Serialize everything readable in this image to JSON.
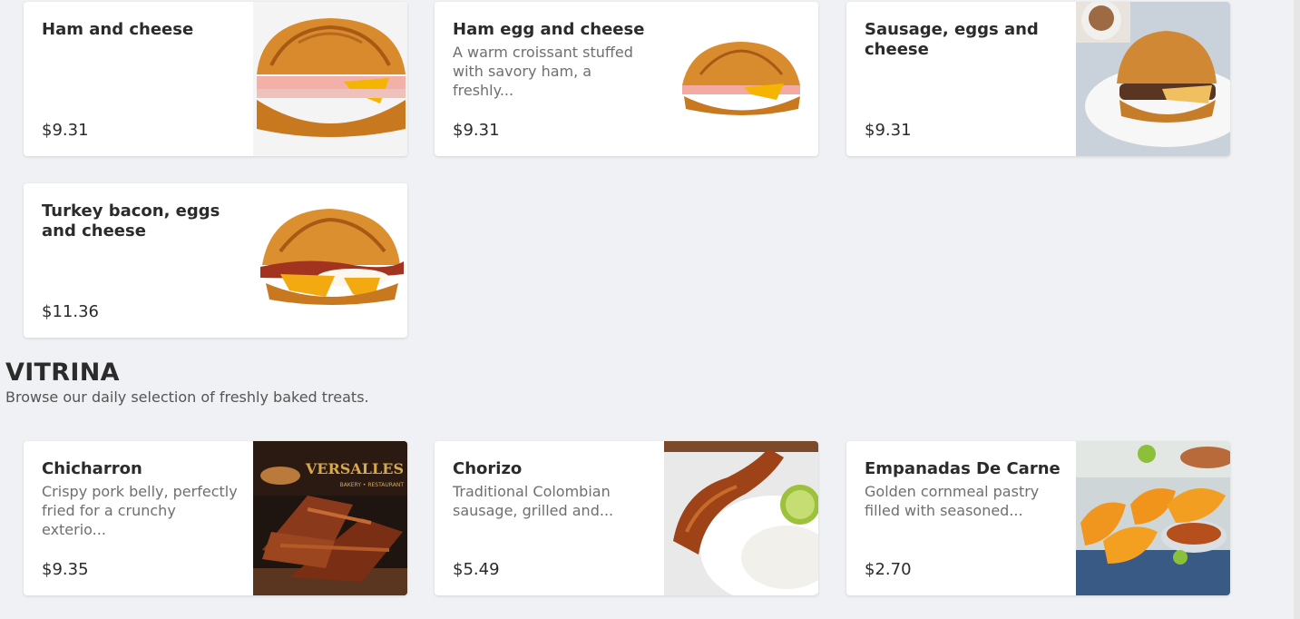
{
  "breakfast": {
    "items": [
      {
        "name": "Ham and cheese",
        "desc": "",
        "price": "$9.31",
        "image": "croissant-sandwich-ham-cheese"
      },
      {
        "name": "Ham egg and cheese",
        "desc": "A warm croissant stuffed with savory ham, a freshly...",
        "price": "$9.31",
        "image": "croissant-sandwich-ham-egg-cheese"
      },
      {
        "name": "Sausage, eggs and cheese",
        "desc": "",
        "price": "$9.31",
        "image": "croissant-sausage-egg-cheese-plate"
      },
      {
        "name": "Turkey bacon, eggs and cheese",
        "desc": "",
        "price": "$11.36",
        "image": "croissant-bacon-egg-cheese"
      }
    ]
  },
  "vitrina": {
    "title": "VITRINA",
    "subtitle": "Browse our daily selection of freshly baked treats.",
    "items": [
      {
        "name": "Chicharron",
        "desc": "Crispy pork belly, perfectly fried for a crunchy exterio...",
        "price": "$9.35",
        "image": "chicharron-board",
        "logo": "VERSALLES",
        "logo_sub": "BAKERY • RESTAURANT"
      },
      {
        "name": "Chorizo",
        "desc": "Traditional Colombian sausage, grilled and...",
        "price": "$5.49",
        "image": "chorizo-arepa-lime"
      },
      {
        "name": "Empanadas De Carne",
        "desc": "Golden cornmeal pastry filled with seasoned...",
        "price": "$2.70",
        "image": "empanadas-salsa-basket"
      }
    ]
  }
}
